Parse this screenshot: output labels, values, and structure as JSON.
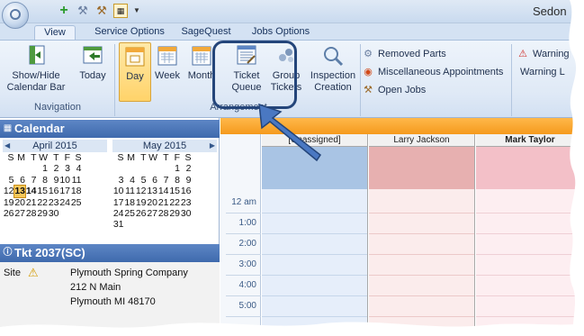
{
  "window": {
    "title": "Sedon"
  },
  "quick_access": {
    "icons": [
      "plus-icon",
      "wrench-icon",
      "hammer-icon",
      "calendar-icon",
      "dropdown-icon"
    ]
  },
  "tabs": [
    {
      "label": "View",
      "active": true
    },
    {
      "label": "Service Options",
      "active": false
    },
    {
      "label": "SageQuest",
      "active": false
    },
    {
      "label": "Jobs Options",
      "active": false
    }
  ],
  "ribbon": {
    "navigation": {
      "label": "Navigation",
      "show_hide": [
        "Show/Hide",
        "Calendar Bar"
      ],
      "today": "Today"
    },
    "arrangement": {
      "label": "Arrangement",
      "day": "Day",
      "week": "Week",
      "month": "Month",
      "ticket_queue": [
        "Ticket",
        "Queue"
      ],
      "group_tickets": [
        "Group",
        "Tickets"
      ],
      "inspection_creation": [
        "Inspection",
        "Creation"
      ]
    },
    "small_items": [
      "Removed Parts",
      "Miscellaneous Appointments",
      "Open Jobs"
    ],
    "warning": [
      "Warning",
      "Warning L"
    ]
  },
  "calendar": {
    "title": "Calendar",
    "april": {
      "title": "April 2015",
      "weekdays": [
        "S",
        "M",
        "T",
        "W",
        "T",
        "F",
        "S"
      ],
      "rows": [
        [
          "",
          "",
          "",
          "1",
          "2",
          "3",
          "4"
        ],
        [
          "5",
          "6",
          "7",
          "8",
          "9",
          "10",
          "11"
        ],
        [
          "12",
          "13",
          "14",
          "15",
          "16",
          "17",
          "18"
        ],
        [
          "19",
          "20",
          "21",
          "22",
          "23",
          "24",
          "25"
        ],
        [
          "26",
          "27",
          "28",
          "29",
          "30",
          "",
          ""
        ]
      ],
      "today": "13"
    },
    "may": {
      "title": "May 2015",
      "weekdays": [
        "S",
        "M",
        "T",
        "W",
        "T",
        "F",
        "S"
      ],
      "rows": [
        [
          "",
          "",
          "",
          "",
          "",
          "1",
          "2"
        ],
        [
          "3",
          "4",
          "5",
          "6",
          "7",
          "8",
          "9"
        ],
        [
          "10",
          "11",
          "12",
          "13",
          "14",
          "15",
          "16"
        ],
        [
          "17",
          "18",
          "19",
          "20",
          "21",
          "22",
          "23"
        ],
        [
          "24",
          "25",
          "26",
          "27",
          "28",
          "29",
          "30"
        ],
        [
          "31",
          "",
          "",
          "",
          "",
          "",
          ""
        ]
      ]
    }
  },
  "ticket": {
    "title": "Tkt 2037(SC)",
    "site_label": "Site",
    "site_name": "Plymouth Spring Company",
    "address1": "212 N Main",
    "address2": "Plymouth MI 48170"
  },
  "schedule": {
    "columns": [
      "[Unassigned]",
      "Larry Jackson",
      "Mark Taylor"
    ],
    "times": [
      "12 am",
      "1:00",
      "2:00",
      "3:00",
      "4:00",
      "5:00"
    ]
  },
  "colors": {
    "accent_orange": "#f59a1d",
    "callout_blue": "#24457a",
    "unassigned": "#a9c4e4",
    "larry": "#e7b0b0",
    "mark": "#f3c0c8"
  }
}
